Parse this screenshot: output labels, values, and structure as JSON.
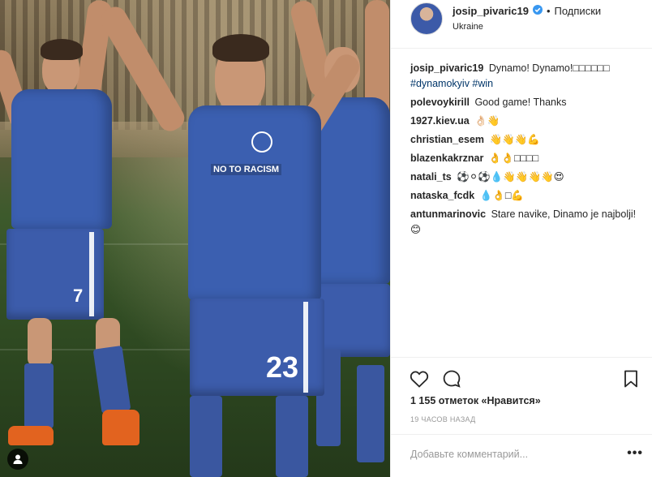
{
  "post": {
    "username": "josip_pivaric19",
    "follow_label": "Подписки",
    "separator": "•",
    "location": "Ukraine",
    "likes_text": "1 155 отметок «Нравится»",
    "time_ago": "19 часов назад",
    "comment_placeholder": "Добавьте комментарий...",
    "more_label": "•••"
  },
  "photo": {
    "name_badge": "NO TO RACISM",
    "number_left": "7",
    "number_center": "23"
  },
  "caption": {
    "author": "josip_pivaric19",
    "text": "Dynamo! Dynamo!□□□□□□",
    "hashtags": "#dynamokyiv #win"
  },
  "comments": [
    {
      "author": "polevoykirill",
      "text": "Good game! Thanks"
    },
    {
      "author": "1927.kiev.ua",
      "text": "👌🏻👋"
    },
    {
      "author": "christian_esem",
      "text": "👋👋👋💪"
    },
    {
      "author": "blazenkakrznar",
      "text": "👌👌□□□□"
    },
    {
      "author": "natali_ts",
      "text": "⚽⚪⚽💧👋👋👋👋😍"
    },
    {
      "author": "nataska_fcdk",
      "text": "💧👌□💪"
    },
    {
      "author": "antunmarinovic",
      "text": "Stare navike, Dinamo je najbolji! 😊"
    }
  ],
  "icons": {
    "like": "heart-icon",
    "comment": "comment-bubble-icon",
    "save": "bookmark-icon",
    "verified": "verified-badge-icon",
    "multi": "user-tag-icon"
  },
  "colors": {
    "text": "#262626",
    "muted": "#999999",
    "hashtag": "#003569",
    "verified": "#3897f0",
    "kit_blue": "#3b5fb0"
  }
}
